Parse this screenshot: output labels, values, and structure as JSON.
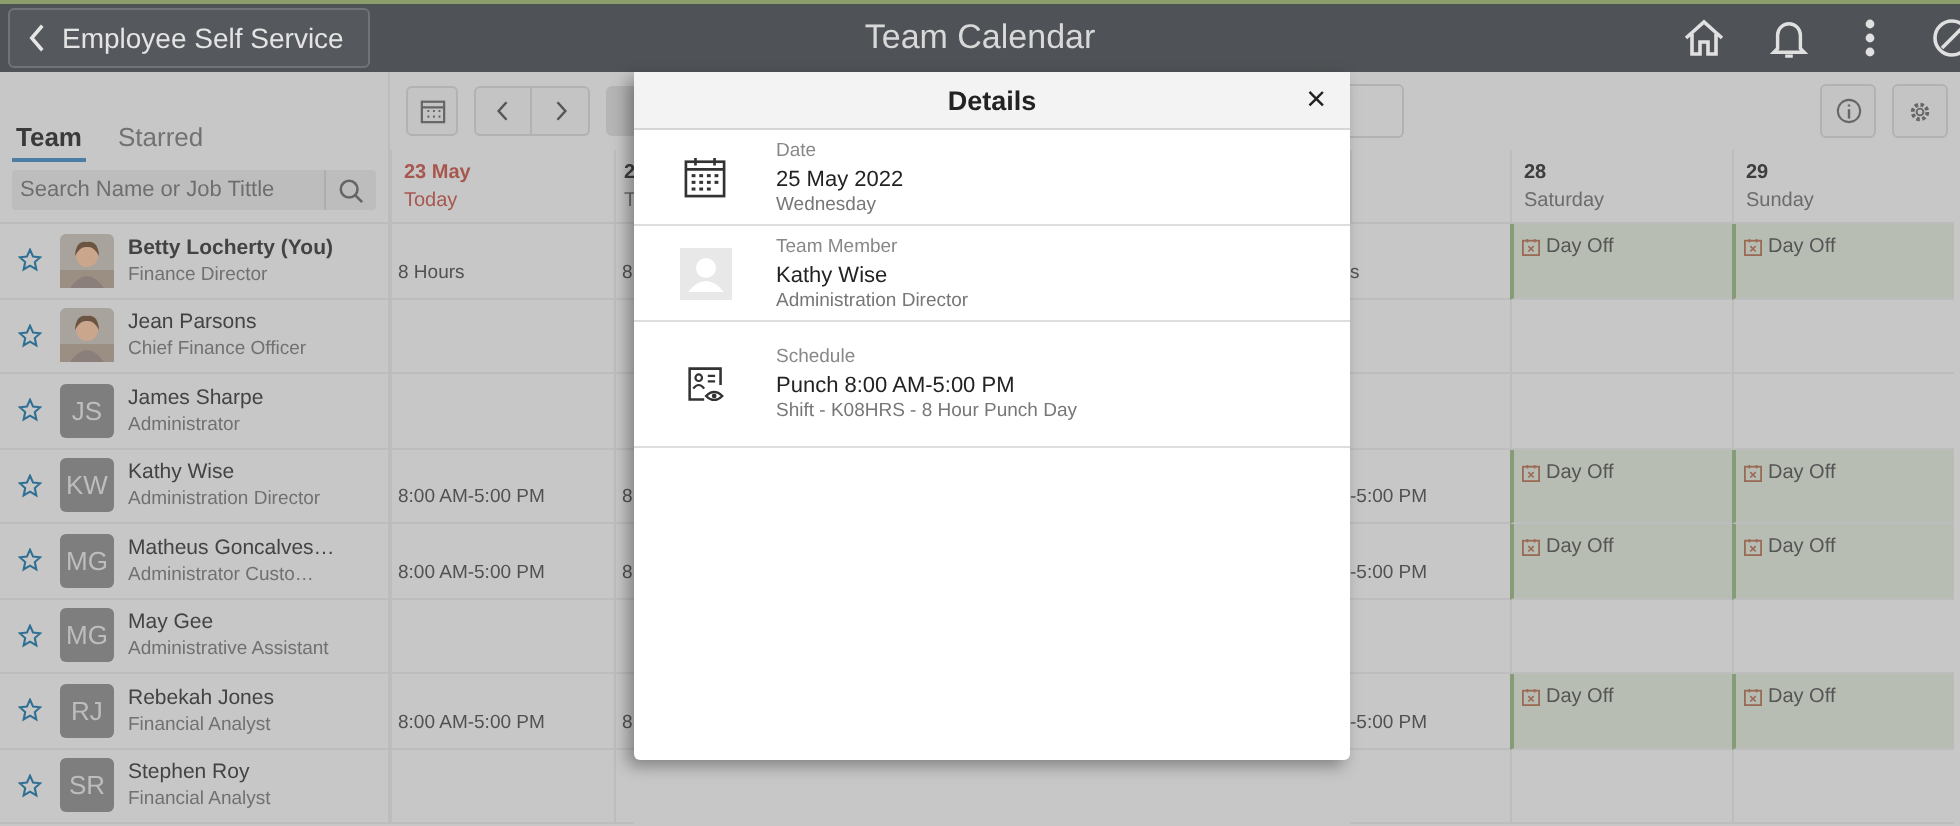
{
  "header": {
    "back_label": "Employee Self Service",
    "title": "Team Calendar"
  },
  "tabs": [
    {
      "label": "Team",
      "selected": true
    },
    {
      "label": "Starred",
      "selected": false
    }
  ],
  "search": {
    "placeholder": "Search Name or Job Tittle"
  },
  "columns": [
    {
      "date": "23 May",
      "weekday": "Today",
      "today": true
    },
    {
      "date": "2",
      "weekday": "T",
      "today": false
    },
    {},
    {
      "date": "28",
      "weekday": "Saturday",
      "today": false
    },
    {
      "date": "29",
      "weekday": "Sunday",
      "today": false
    }
  ],
  "rows": [
    {
      "name": "Betty Locherty (You)",
      "title": "Finance Director",
      "is_you": true,
      "cells": [
        {
          "kind": "text",
          "text": "8 Hours"
        },
        {
          "kind": "text",
          "text": "8"
        },
        {
          "kind": "text",
          "text": "s"
        },
        {
          "kind": "day_off",
          "text": "Day Off"
        },
        {
          "kind": "day_off",
          "text": "Day Off"
        }
      ]
    },
    {
      "name": "Jean Parsons",
      "title": "Chief Finance Officer",
      "is_you": false,
      "cells": [
        {
          "kind": "blank"
        },
        {
          "kind": "blank"
        },
        {
          "kind": "blank"
        },
        {
          "kind": "blank"
        },
        {
          "kind": "blank"
        }
      ]
    },
    {
      "name": "James Sharpe",
      "title": "Administrator",
      "avatar": {
        "kind": "initials",
        "initials": "JS"
      },
      "is_you": false,
      "cells": [
        {
          "kind": "blank"
        },
        {
          "kind": "blank"
        },
        {
          "kind": "blank"
        },
        {
          "kind": "blank"
        },
        {
          "kind": "blank"
        }
      ]
    },
    {
      "name": "Kathy Wise",
      "title": "Administration Director",
      "avatar": {
        "kind": "initials",
        "initials": "KW"
      },
      "is_you": false,
      "cells": [
        {
          "kind": "text",
          "text": "8:00 AM-5:00 PM"
        },
        {
          "kind": "text",
          "text": "8"
        },
        {
          "kind": "text",
          "text": "-5:00 PM"
        },
        {
          "kind": "day_off",
          "text": "Day Off"
        },
        {
          "kind": "day_off",
          "text": "Day Off"
        }
      ]
    },
    {
      "name": "Matheus Goncalves…",
      "title": "Administrator Custo…",
      "avatar": {
        "kind": "initials",
        "initials": "MG"
      },
      "is_you": false,
      "cells": [
        {
          "kind": "text",
          "text": "8:00 AM-5:00 PM"
        },
        {
          "kind": "text",
          "text": "8"
        },
        {
          "kind": "text",
          "text": "-5:00 PM"
        },
        {
          "kind": "day_off",
          "text": "Day Off"
        },
        {
          "kind": "day_off",
          "text": "Day Off"
        }
      ]
    },
    {
      "name": "May Gee",
      "title": "Administrative Assistant",
      "avatar": {
        "kind": "initials",
        "initials": "MG"
      },
      "is_you": false,
      "cells": [
        {
          "kind": "blank"
        },
        {
          "kind": "blank"
        },
        {
          "kind": "blank"
        },
        {
          "kind": "blank"
        },
        {
          "kind": "blank"
        }
      ]
    },
    {
      "name": "Rebekah Jones",
      "title": "Financial Analyst",
      "avatar": {
        "kind": "initials",
        "initials": "RJ"
      },
      "is_you": false,
      "cells": [
        {
          "kind": "text",
          "text": "8:00 AM-5:00 PM"
        },
        {
          "kind": "text",
          "text": "8"
        },
        {
          "kind": "text",
          "text": "-5:00 PM"
        },
        {
          "kind": "day_off",
          "text": "Day Off"
        },
        {
          "kind": "day_off",
          "text": "Day Off"
        }
      ]
    },
    {
      "name": "Stephen Roy",
      "title": "Financial Analyst",
      "avatar": {
        "kind": "initials",
        "initials": "SR"
      },
      "is_you": false,
      "cells": [
        {
          "kind": "blank"
        },
        {
          "kind": "blank"
        },
        {
          "kind": "blank"
        },
        {
          "kind": "blank"
        },
        {
          "kind": "blank"
        }
      ]
    }
  ],
  "details": {
    "title": "Details",
    "close": "×",
    "sections": [
      {
        "kind": "calendar",
        "label": "Date",
        "value": "25 May 2022",
        "detail": "Wednesday"
      },
      {
        "kind": "person",
        "label": "Team Member",
        "value": "Kathy Wise",
        "detail": "Administration Director"
      },
      {
        "kind": "schedule",
        "label": "Schedule",
        "value": "Punch 8:00 AM-5:00 PM",
        "detail": "Shift - K08HRS - 8 Hour Punch Day"
      }
    ]
  }
}
